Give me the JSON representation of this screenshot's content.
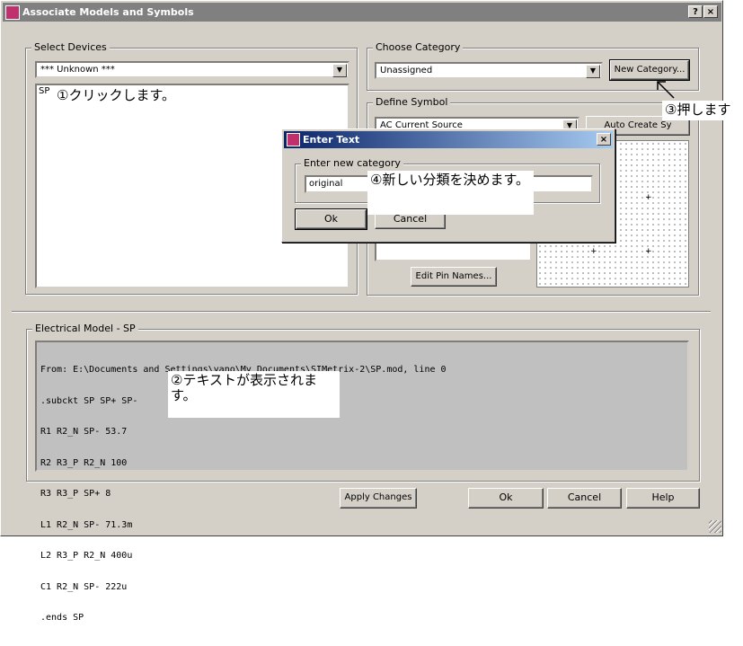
{
  "window": {
    "title": "Associate Models and Symbols",
    "help_btn": "?",
    "close_btn": "×"
  },
  "select_devices": {
    "legend": "Select Devices",
    "combo_value": "*** Unknown ***",
    "list_items": [
      "SP"
    ]
  },
  "choose_category": {
    "legend": "Choose Category",
    "combo_value": "Unassigned",
    "new_category_button": "New Category..."
  },
  "define_symbol": {
    "legend": "Define Symbol",
    "combo_value": "AC Current Source",
    "auto_create_button": "Auto Create Sy",
    "edit_pins_button": "Edit Pin Names..."
  },
  "enter_text_dialog": {
    "title": "Enter Text",
    "close_btn": "×",
    "legend": "Enter new category",
    "input_value": "original",
    "ok_button": "Ok",
    "cancel_button": "Cancel"
  },
  "electrical_model": {
    "legend": "Electrical Model - SP",
    "lines": [
      "From: E:\\Documents and Settings\\yano\\My Documents\\SIMetrix-2\\SP.mod, line 0",
      ".subckt SP SP+ SP-",
      "R1 R2_N SP- 53.7",
      "R2 R3_P R2_N 100",
      "R3 R3_P SP+ 8",
      "L1 R2_N SP- 71.3m",
      "L2 R3_P R2_N 400u",
      "C1 R2_N SP- 222u",
      ".ends SP"
    ]
  },
  "footer": {
    "apply_button": "Apply Changes",
    "ok_button": "Ok",
    "cancel_button": "Cancel",
    "help_button": "Help"
  },
  "annotations": {
    "note1": "①クリックします。",
    "note2": "②テキストが表示されます。",
    "note3": "③押します",
    "note4": "④新しい分類を決めます。"
  }
}
